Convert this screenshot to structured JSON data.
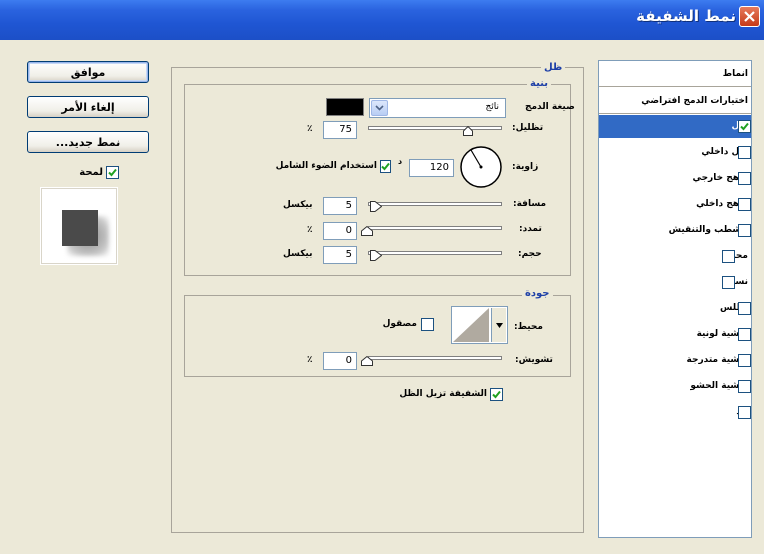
{
  "window": {
    "title": "نمط الشفيفة"
  },
  "buttons": {
    "ok": "موافق",
    "cancel": "إلغاء الأمر",
    "new_style": "نمط جديد...",
    "preview": "لمحة"
  },
  "style_list": {
    "header": "انماط",
    "blend_options": "اختيارات الدمج افتراضي",
    "items": [
      {
        "label": "ظل",
        "checked": true,
        "selected": true
      },
      {
        "label": "ظل داخلي",
        "checked": false
      },
      {
        "label": "توهج خارجي",
        "checked": false
      },
      {
        "label": "توهج داخلي",
        "checked": false
      },
      {
        "label": "الشطب والتنقيش",
        "checked": false
      },
      {
        "label": "محيط",
        "checked": false
      },
      {
        "label": "نسيج",
        "checked": false
      },
      {
        "label": "اطلس",
        "checked": false
      },
      {
        "label": "تغشية لونية",
        "checked": false
      },
      {
        "label": "تغشية متدرجة",
        "checked": false
      },
      {
        "label": "تغشية الحشو",
        "checked": false
      },
      {
        "label": "حد",
        "checked": false
      }
    ]
  },
  "shadow_panel": {
    "title": "ظل",
    "structure": {
      "title": "بنية",
      "blend_mode_label": "صيغة الدمج",
      "blend_mode_value": "نائج",
      "blend_color": "#000000",
      "opacity_label": "تظليل:",
      "opacity_value": "75",
      "opacity_unit": "٪",
      "angle_label": "زاوية:",
      "angle_value": "120",
      "angle_unit": "د",
      "global_light_label": "استخدام الضوء الشامل",
      "global_light_checked": true,
      "distance_label": "مسافة:",
      "distance_value": "5",
      "distance_unit": "بيكسل",
      "spread_label": "تمدد:",
      "spread_value": "0",
      "spread_unit": "٪",
      "size_label": "حجم:",
      "size_value": "5",
      "size_unit": "بيكسل"
    },
    "quality": {
      "title": "جودة",
      "contour_label": "محيط:",
      "antialiased_label": "مصقول",
      "antialiased_checked": false,
      "noise_label": "تشويش:",
      "noise_value": "0",
      "noise_unit": "٪"
    },
    "knockout_label": "الشفيفة تزيل الظل",
    "knockout_checked": true
  },
  "colors": {
    "titlebar": "#245edb",
    "dialog_bg": "#ece9d8",
    "selection": "#316ac5",
    "group_title": "#1d3fa7"
  }
}
